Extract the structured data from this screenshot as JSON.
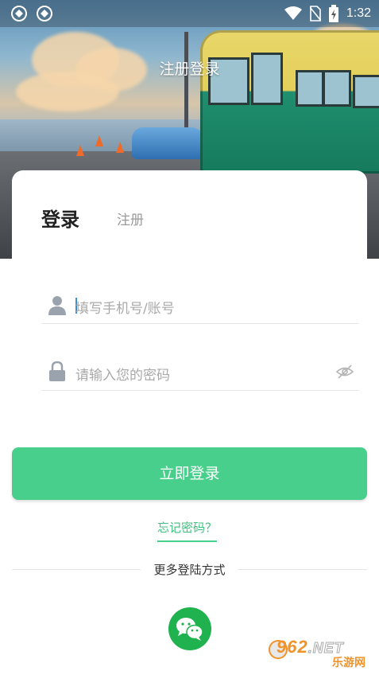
{
  "status_bar": {
    "time": "1:32",
    "icons": [
      "sync-icon",
      "sync-icon",
      "wifi-icon",
      "no-sim-icon",
      "battery-charging-icon"
    ]
  },
  "header": {
    "title": "注册登录"
  },
  "auth_tabs": {
    "login": "登录",
    "register": "注册"
  },
  "phone_field": {
    "placeholder": "填写手机号/账号",
    "icon": "user-icon"
  },
  "password_field": {
    "placeholder": "请输入您的密码",
    "icon": "lock-icon",
    "toggle_icon": "eye-hidden-icon"
  },
  "login_button": "立即登录",
  "forgot_password": "忘记密码？",
  "more_login": "更多登陆方式",
  "social": {
    "wechat_icon": "wechat-icon"
  },
  "watermark": {
    "brand": "962",
    "suffix": ".NET",
    "subtitle": "乐游网"
  },
  "colors": {
    "accent": "#47cf8b",
    "link": "#3fc07e",
    "wechat": "#20b24f"
  }
}
